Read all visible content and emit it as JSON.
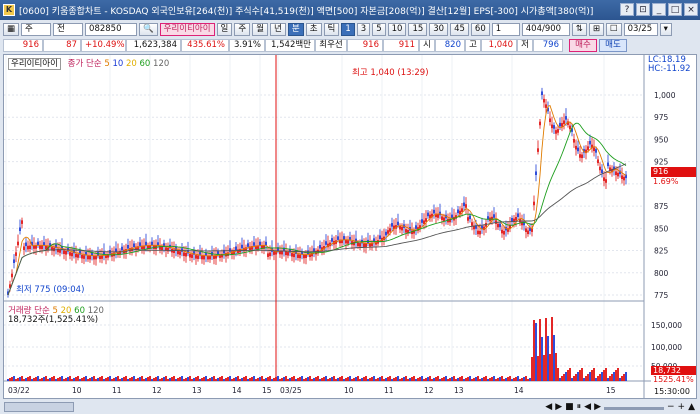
{
  "title": "[0600] 키움종합차트 - KOSDAQ 외국인보유[264(천)] 주식수[41,519(천)] 액면[500] 자본금[208(억)] 결산[12월] EPS[-300] 시가총액[380(억)]",
  "toolbar": {
    "market": "주",
    "field": "전",
    "code": "082850",
    "stock_name": "우리이티아이",
    "periods": [
      "일",
      "주",
      "월",
      "년",
      "분",
      "초",
      "틱"
    ],
    "active_period": "분",
    "intervals": [
      "1",
      "3",
      "5",
      "10",
      "15",
      "30",
      "45",
      "60"
    ],
    "active_interval": "1",
    "interval_value": "1",
    "count": "404/900",
    "date": "03/25"
  },
  "quote": {
    "price": "916",
    "change": "87",
    "rate": "+10.49%",
    "volume": "1,623,384",
    "vol_rate": "435.61%",
    "turnover": "3.91%",
    "amount": "1,542백만",
    "pref_label": "최우선",
    "bid1": "916",
    "bid2": "911",
    "open_label": "시",
    "open": "820",
    "high_label": "고",
    "high": "1,040",
    "low_label": "저",
    "low": "796",
    "buy_label": "매수",
    "sell_label": "매도"
  },
  "chart": {
    "name_label": "우리이티아이",
    "price_legend": "종가 단순",
    "ma": [
      "5",
      "10",
      "20",
      "60",
      "120"
    ],
    "high_annotation": "최고 1,040 (13:29)",
    "low_annotation": "최저 775 (09:04)",
    "lc": "LC:18.19",
    "hc": "HC:-11.92",
    "current_price_tag": "916",
    "current_pct_tag": "1.69%",
    "y_ticks": [
      "1,000",
      "975",
      "950",
      "925",
      "900",
      "875",
      "850",
      "825",
      "800",
      "775"
    ],
    "vol_legend": "거래량 단순",
    "vol_ma": [
      "5",
      "20",
      "60",
      "120"
    ],
    "vol_value": "18,732주(1,525.41%)",
    "vol_ticks": [
      "150,000",
      "100,000",
      "50,000"
    ],
    "vol_tag": "18,732",
    "vol_pct_tag": "1525.41%",
    "x_ticks": [
      "03/22",
      "10",
      "11",
      "12",
      "13",
      "14",
      "15",
      "03/25",
      "10",
      "11",
      "12",
      "13",
      "14",
      "15"
    ],
    "colors": {
      "up": "#e01010",
      "down": "#1a3bd6",
      "ma5": "#e07c00",
      "ma10": "#1e9e1e",
      "ma20": "#555555"
    }
  },
  "bottom": {
    "time": "15:30:00",
    "controls": [
      "◀",
      "▶",
      "■",
      "⏸",
      "◀",
      "▶",
      "−",
      "+",
      "▲"
    ]
  }
}
